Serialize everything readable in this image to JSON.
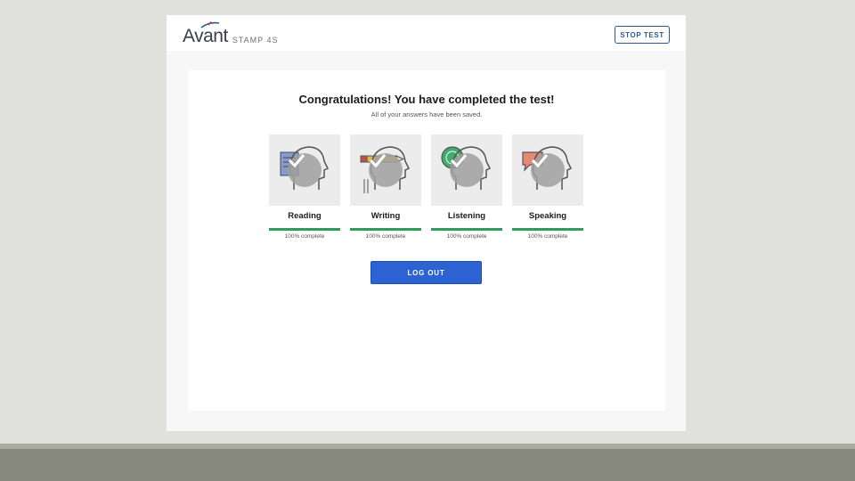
{
  "header": {
    "logo_word": "Avant",
    "logo_sub": "STAMP 4S",
    "stop_label": "STOP TEST"
  },
  "main": {
    "title": "Congratulations! You have completed the test!",
    "subtitle": "All of your answers have been saved.",
    "sections": [
      {
        "label": "Reading",
        "progress_text": "100% complete",
        "progress": 100,
        "icon": "reading-icon"
      },
      {
        "label": "Writing",
        "progress_text": "100% complete",
        "progress": 100,
        "icon": "writing-icon"
      },
      {
        "label": "Listening",
        "progress_text": "100% complete",
        "progress": 100,
        "icon": "listening-icon"
      },
      {
        "label": "Speaking",
        "progress_text": "100% complete",
        "progress": 100,
        "icon": "speaking-icon"
      }
    ],
    "logout_label": "LOG OUT"
  },
  "colors": {
    "accent_blue": "#2c62d1",
    "progress_green": "#2e9d5c",
    "stop_border": "#2e5a8f"
  }
}
